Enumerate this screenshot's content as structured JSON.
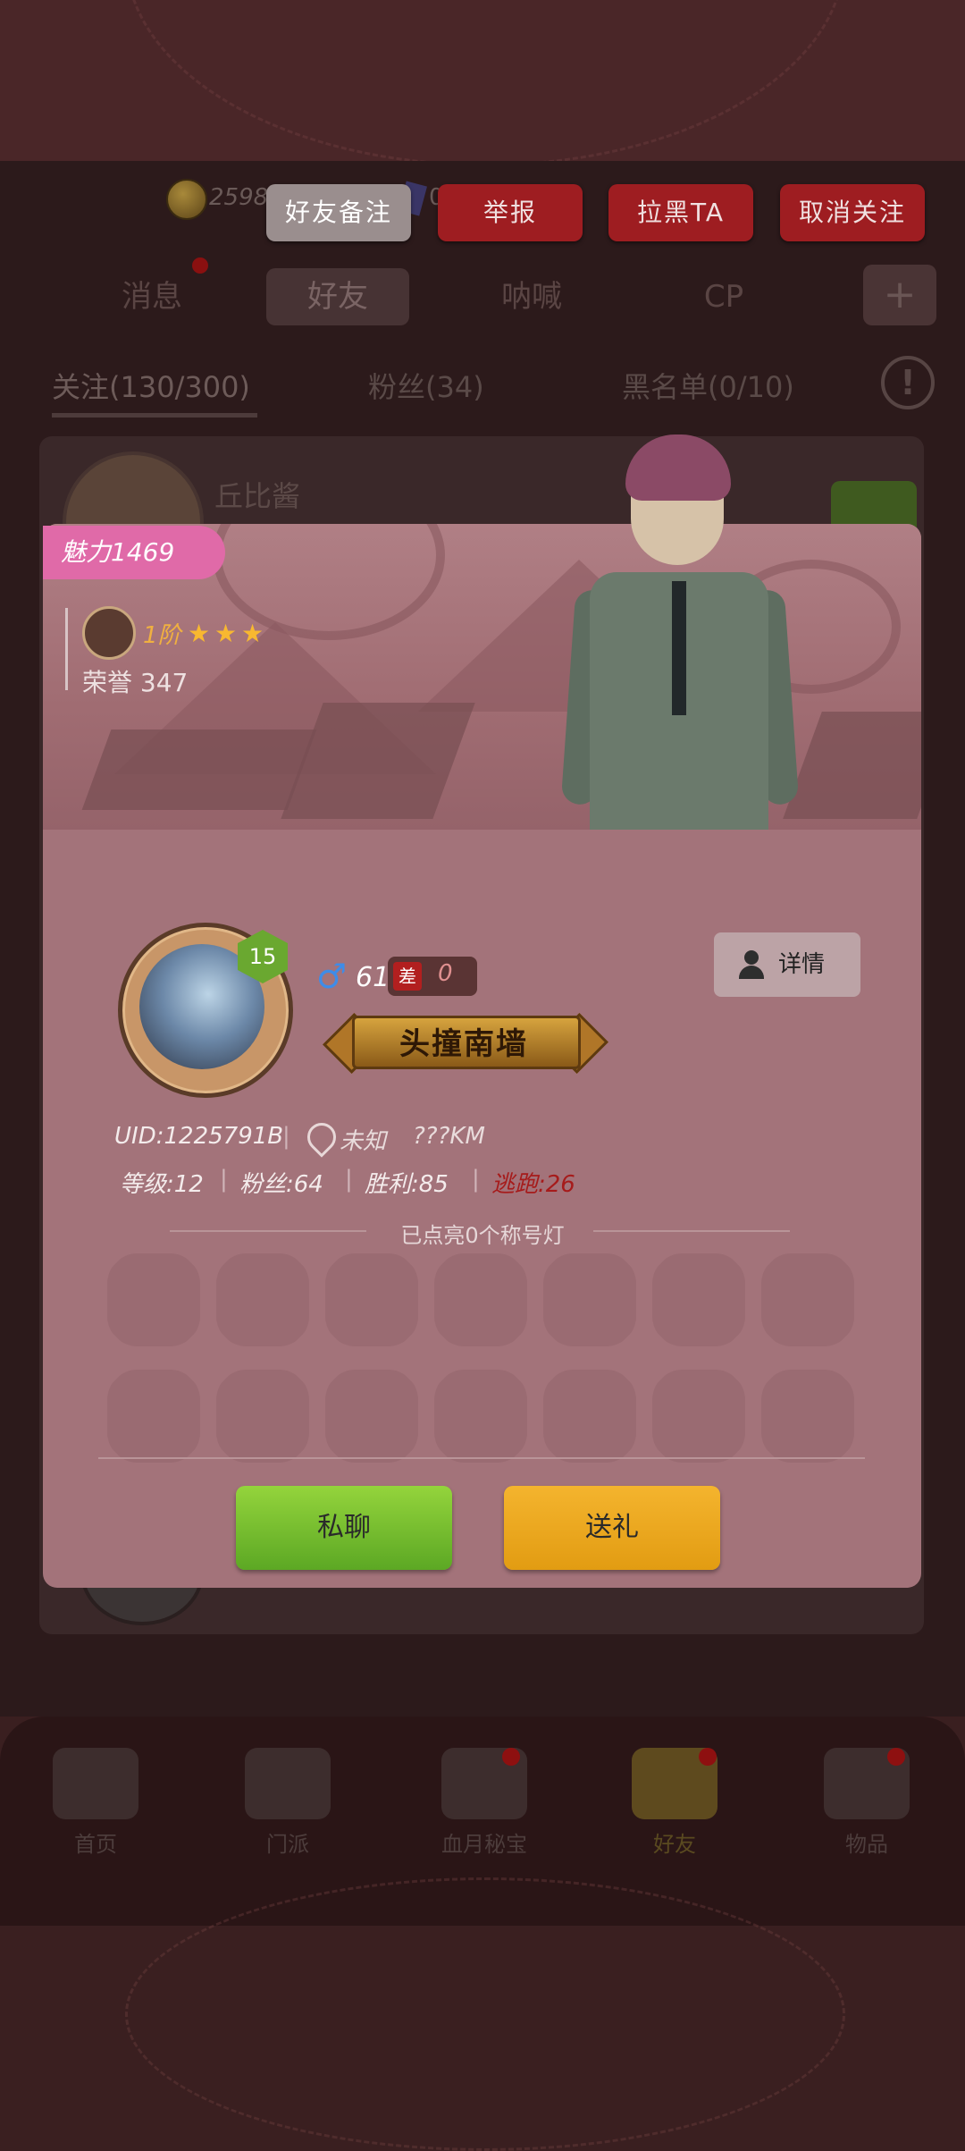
{
  "resources": {
    "coins": "2598",
    "gems": "0"
  },
  "actions": {
    "remark": "好友备注",
    "report": "举报",
    "block": "拉黑TA",
    "unfollow": "取消关注"
  },
  "tabs": [
    "消息",
    "好友",
    "呐喊",
    "CP"
  ],
  "subtabs": [
    "关注(130/300)",
    "粉丝(34)",
    "黑名单(0/10)"
  ],
  "list": {
    "first_name": "丘比酱"
  },
  "profile": {
    "charm": "魅力1469",
    "rank": "1阶",
    "rank_stars": 3,
    "honor": "荣誉 347",
    "level": "15",
    "gender_symbol": "♂",
    "age": "61",
    "diff_label": "差",
    "diff_value": "0",
    "title": "头撞南墙",
    "detail_button": "详情",
    "uid": "UID:1225791B",
    "location": "未知",
    "distance": "???KM",
    "grade": "等级:12",
    "fans": "粉丝:64",
    "wins": "胜利:85",
    "escapes": "逃跑:26",
    "lamps_lit_text": "已点亮0个称号灯",
    "chat_button": "私聊",
    "gift_button": "送礼"
  },
  "bottom_nav": [
    "首页",
    "门派",
    "血月秘宝",
    "好友",
    "物品"
  ],
  "colors": {
    "accent_red": "#9e1d21",
    "charm_pink": "#e06aa8",
    "chat_green": "#7cc232",
    "gift_orange": "#eba620",
    "card_bg": "#a3737a"
  }
}
